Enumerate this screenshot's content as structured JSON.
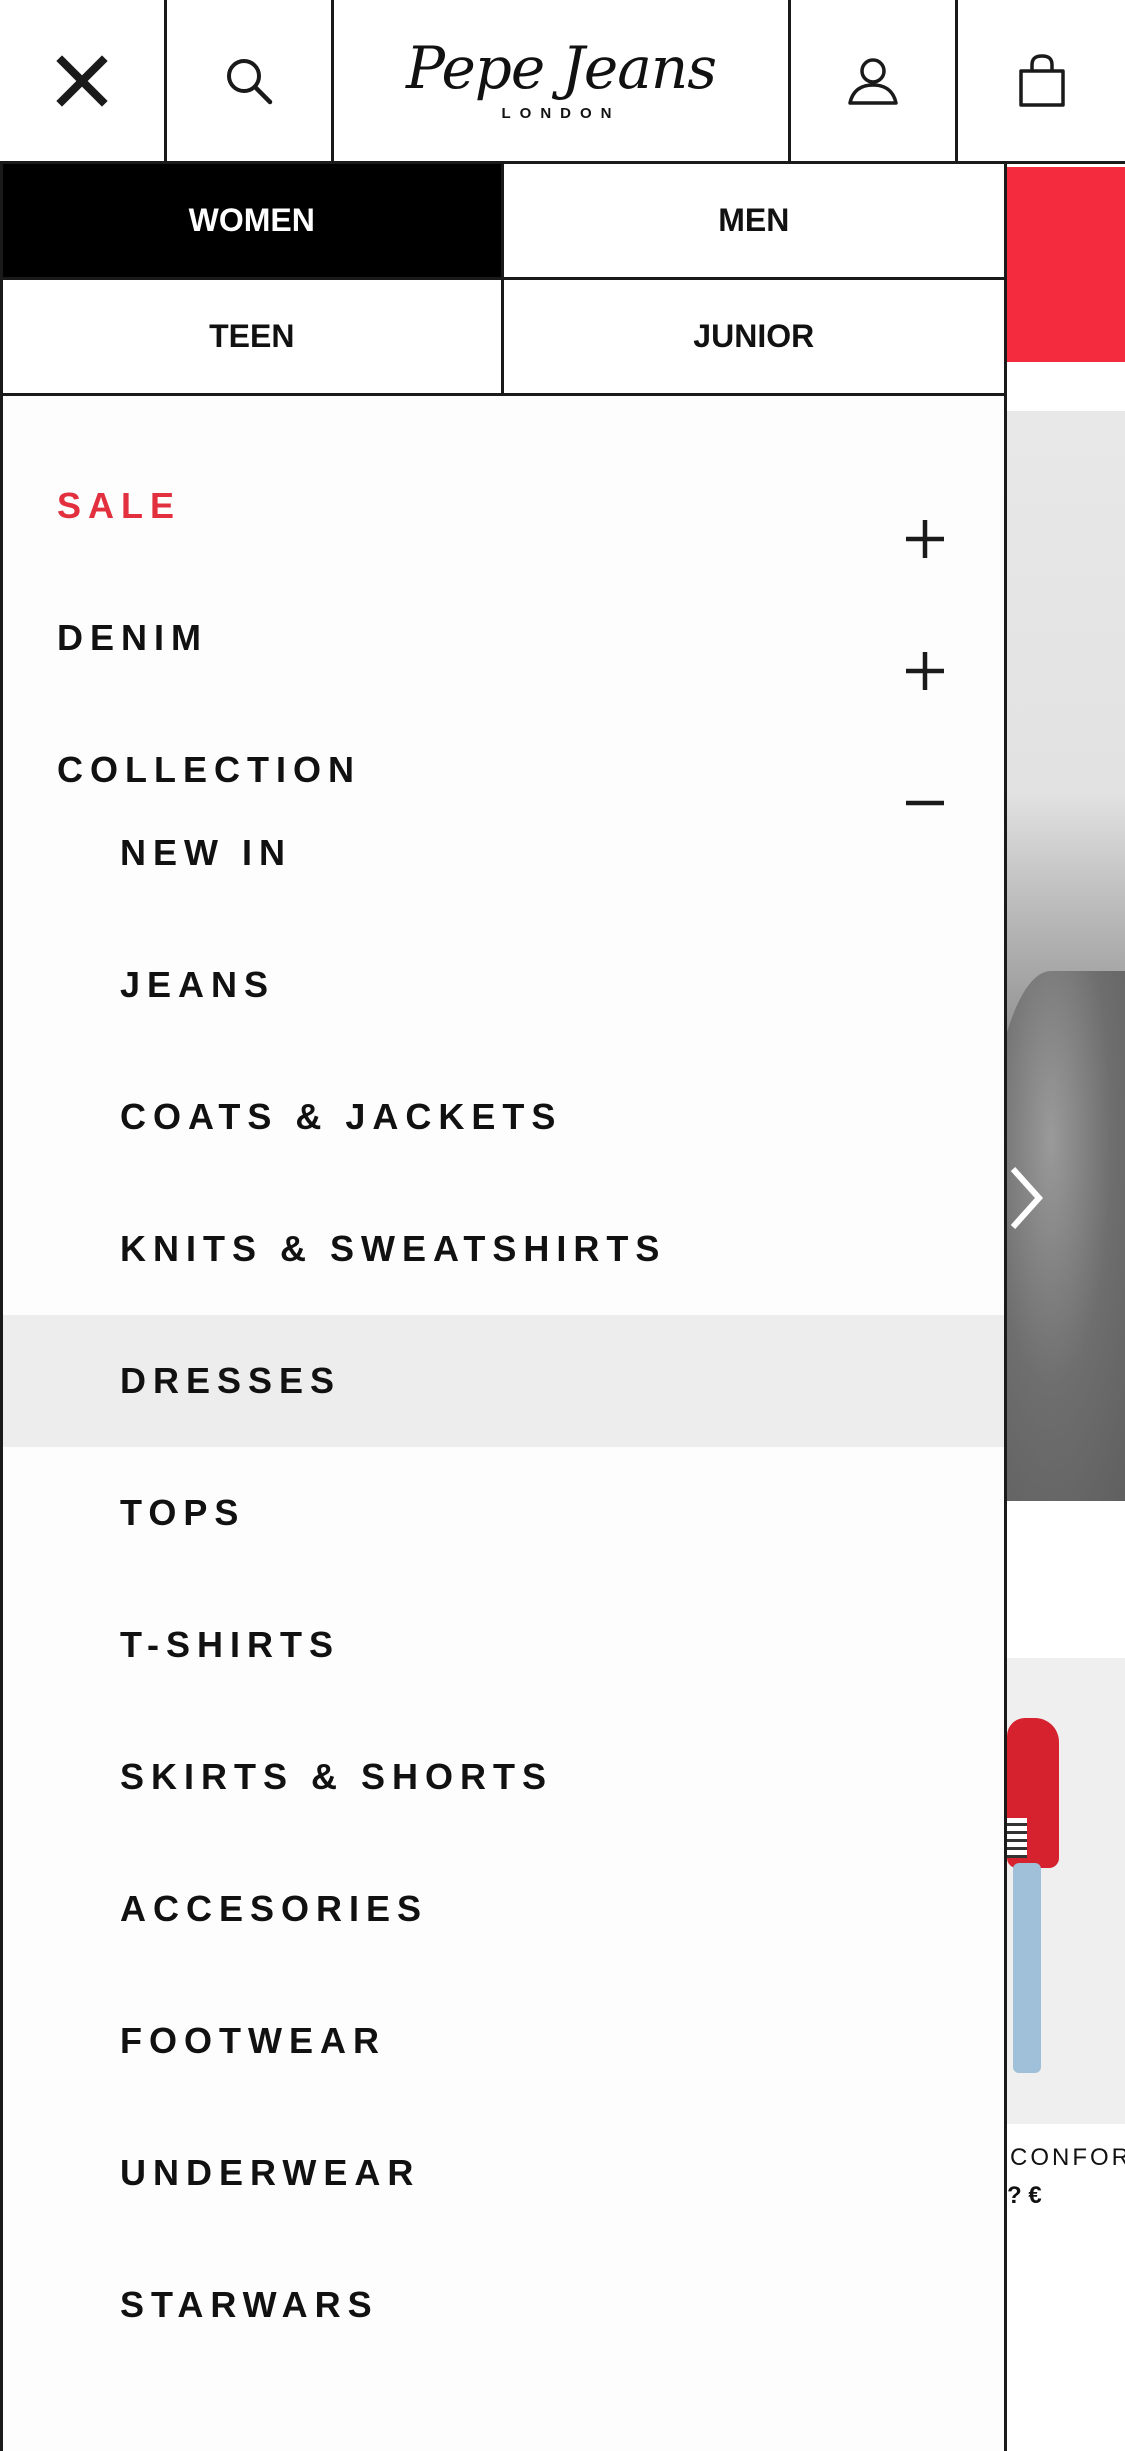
{
  "header": {
    "logo_text": "Pepe Jeans",
    "logo_subtext": "LONDON",
    "icons": {
      "close": "close-icon",
      "search": "search-icon",
      "account": "user-icon",
      "bag": "shopping-bag-icon"
    }
  },
  "gender_tabs": [
    {
      "label": "WOMEN",
      "active": true
    },
    {
      "label": "MEN",
      "active": false
    },
    {
      "label": "TEEN",
      "active": false
    },
    {
      "label": "JUNIOR",
      "active": false
    }
  ],
  "menu": {
    "top_items": [
      {
        "label": "SALE",
        "expanded": false,
        "toggle": "+"
      },
      {
        "label": "DENIM",
        "expanded": false,
        "toggle": "+"
      },
      {
        "label": "COLLECTION",
        "expanded": true,
        "toggle": "−"
      }
    ],
    "collection_items": [
      {
        "label": "NEW IN"
      },
      {
        "label": "JEANS"
      },
      {
        "label": "COATS & JACKETS"
      },
      {
        "label": "KNITS & SWEATSHIRTS"
      },
      {
        "label": "DRESSES",
        "highlighted": true
      },
      {
        "label": "TOPS"
      },
      {
        "label": "T-SHIRTS"
      },
      {
        "label": "SKIRTS & SHORTS"
      },
      {
        "label": "ACCESORIES"
      },
      {
        "label": "FOOTWEAR"
      },
      {
        "label": "UNDERWEAR"
      },
      {
        "label": "STARWARS"
      }
    ]
  },
  "background_page": {
    "product_name_fragment": "CONFOR",
    "product_price_fragment": "? €"
  },
  "colors": {
    "sale": "#e2303f",
    "promo_strip": "#f42a3e",
    "active_tab_bg": "#000000",
    "highlight_row": "#ededed"
  }
}
